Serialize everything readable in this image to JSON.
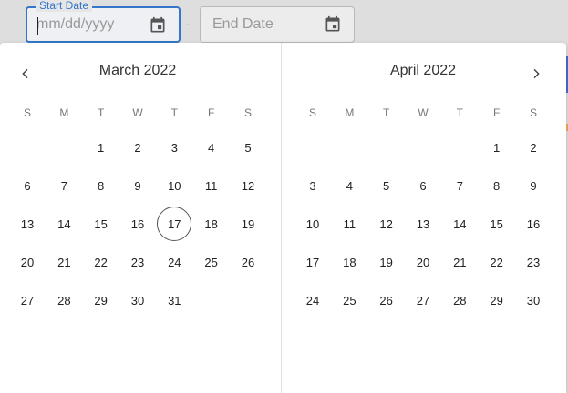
{
  "date_range": {
    "start": {
      "label": "Start Date",
      "placeholder": "mm/dd/yyyy",
      "value": ""
    },
    "separator": "-",
    "end": {
      "label": "",
      "placeholder": "End Date",
      "value": ""
    }
  },
  "picker": {
    "weekdays": [
      "S",
      "M",
      "T",
      "W",
      "T",
      "F",
      "S"
    ],
    "months": [
      {
        "title": "March 2022",
        "lead_blanks": 2,
        "days": 31,
        "today": 17
      },
      {
        "title": "April 2022",
        "lead_blanks": 5,
        "days": 30,
        "today": null
      }
    ]
  },
  "colors": {
    "accent": "#3576c8",
    "today_ring": "#555555"
  },
  "icons": {
    "prev": "chevron-left-icon",
    "next": "chevron-right-icon",
    "calendar": "calendar-icon"
  }
}
